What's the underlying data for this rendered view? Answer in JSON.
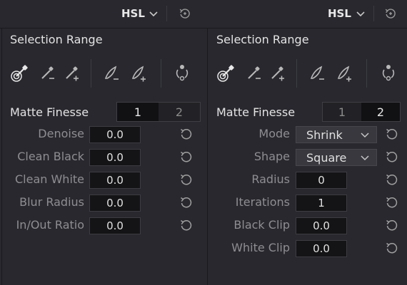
{
  "left": {
    "header_mode": "HSL",
    "section_title": "Selection Range",
    "matte_finesse": "Matte Finesse",
    "tabs": [
      "1",
      "2"
    ],
    "active_tab": 0,
    "params": [
      {
        "label": "Denoise",
        "value": "0.0"
      },
      {
        "label": "Clean Black",
        "value": "0.0"
      },
      {
        "label": "Clean White",
        "value": "0.0"
      },
      {
        "label": "Blur Radius",
        "value": "0.0"
      },
      {
        "label": "In/Out Ratio",
        "value": "0.0"
      }
    ]
  },
  "right": {
    "header_mode": "HSL",
    "section_title": "Selection Range",
    "matte_finesse": "Matte Finesse",
    "tabs": [
      "1",
      "2"
    ],
    "active_tab": 1,
    "mode": {
      "label": "Mode",
      "value": "Shrink"
    },
    "shape": {
      "label": "Shape",
      "value": "Square"
    },
    "params": [
      {
        "label": "Radius",
        "value": "0"
      },
      {
        "label": "Iterations",
        "value": "1"
      },
      {
        "label": "Black Clip",
        "value": "0.0"
      },
      {
        "label": "White Clip",
        "value": "0.0"
      }
    ]
  },
  "icons": {
    "picker": "eyedropper-picker-icon",
    "minus": "eyedropper-subtract-icon",
    "plus": "eyedropper-add-icon",
    "soft_minus": "softness-subtract-icon",
    "soft_plus": "softness-add-icon",
    "invert": "invert-selection-icon",
    "reset": "reset-icon"
  }
}
